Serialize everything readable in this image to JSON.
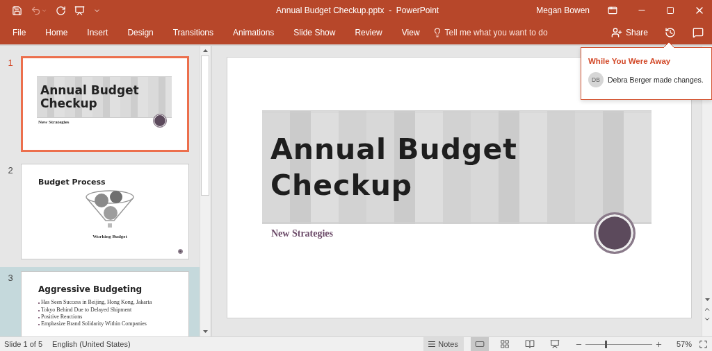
{
  "window": {
    "title": "Annual Budget Checkup.pptx  -  PowerPoint",
    "user": "Megan Bowen"
  },
  "ribbon": {
    "tabs": [
      {
        "label": "File"
      },
      {
        "label": "Home"
      },
      {
        "label": "Insert"
      },
      {
        "label": "Design"
      },
      {
        "label": "Transitions"
      },
      {
        "label": "Animations"
      },
      {
        "label": "Slide Show"
      },
      {
        "label": "Review"
      },
      {
        "label": "View"
      }
    ],
    "search": {
      "placeholder": "Tell me what you want to do"
    },
    "share": "Share"
  },
  "slides_panel": {
    "slides": [
      {
        "number": "1",
        "selected": true,
        "hovered": false,
        "kind": "title",
        "title_lines": [
          "Annual Budget",
          "Checkup"
        ],
        "subtitle": "New Strategies"
      },
      {
        "number": "2",
        "selected": false,
        "hovered": false,
        "kind": "diagram",
        "title": "Budget Process",
        "caption": "Working Budget"
      },
      {
        "number": "3",
        "selected": false,
        "hovered": true,
        "kind": "bullets",
        "title": "Aggressive Budgeting",
        "bullets": [
          "Has Seen Success in Beijing, Hong Kong, Jakarta",
          "Tokyo Behind Due to Delayed Shipment",
          "Positive Reactions",
          "Emphasize Brand Solidarity Within Companies"
        ]
      }
    ]
  },
  "editor": {
    "slide": {
      "title_lines": [
        "Annual Budget",
        "Checkup"
      ],
      "subtitle": "New Strategies"
    }
  },
  "notification": {
    "heading": "While You Were Away",
    "initials": "DB",
    "message": "Debra Berger made changes."
  },
  "status_bar": {
    "slide_info": "Slide 1 of 5",
    "language": "English (United States)",
    "notes": "Notes",
    "views": [
      {
        "kind": "normal",
        "selected": true
      },
      {
        "kind": "sorter",
        "selected": false
      },
      {
        "kind": "reading",
        "selected": false
      },
      {
        "kind": "slideshow",
        "selected": false
      }
    ],
    "zoom": {
      "level": 0.29,
      "reading": "57%"
    }
  }
}
